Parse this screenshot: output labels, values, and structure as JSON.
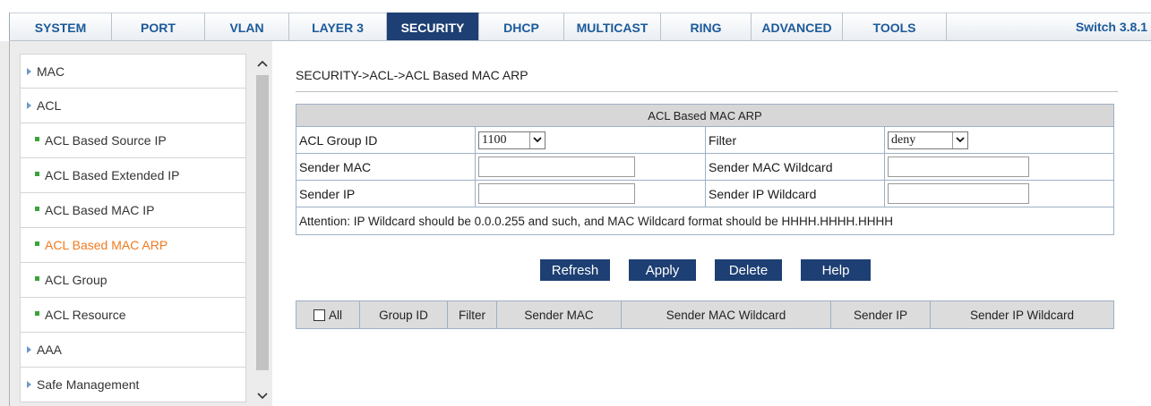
{
  "nav": {
    "tabs": [
      {
        "label": "SYSTEM"
      },
      {
        "label": "PORT"
      },
      {
        "label": "VLAN"
      },
      {
        "label": "LAYER 3"
      },
      {
        "label": "SECURITY",
        "active": true
      },
      {
        "label": "DHCP"
      },
      {
        "label": "MULTICAST"
      },
      {
        "label": "RING"
      },
      {
        "label": "ADVANCED"
      },
      {
        "label": "TOOLS"
      }
    ],
    "version": "Switch 3.8.1"
  },
  "sidebar": {
    "items": [
      {
        "label": "MAC",
        "level": 1
      },
      {
        "label": "ACL",
        "level": 1
      },
      {
        "label": "ACL Based Source IP",
        "level": 2
      },
      {
        "label": "ACL Based Extended IP",
        "level": 2
      },
      {
        "label": "ACL Based MAC IP",
        "level": 2
      },
      {
        "label": "ACL Based MAC ARP",
        "level": 2,
        "active": true
      },
      {
        "label": "ACL Group",
        "level": 2
      },
      {
        "label": "ACL Resource",
        "level": 2
      },
      {
        "label": "AAA",
        "level": 1
      },
      {
        "label": "Safe Management",
        "level": 1
      }
    ]
  },
  "main": {
    "breadcrumb": "SECURITY->ACL->ACL Based MAC ARP",
    "form": {
      "title": "ACL Based MAC ARP",
      "group_id_label": "ACL Group ID",
      "group_id_value": "1100",
      "filter_label": "Filter",
      "filter_value": "deny",
      "sender_mac_label": "Sender MAC",
      "sender_mac_value": "",
      "sender_mac_wildcard_label": "Sender MAC Wildcard",
      "sender_mac_wildcard_value": "",
      "sender_ip_label": "Sender IP",
      "sender_ip_value": "",
      "sender_ip_wildcard_label": "Sender IP Wildcard",
      "sender_ip_wildcard_value": "",
      "attention": "Attention: IP Wildcard should be 0.0.0.255 and such, and MAC Wildcard format should be HHHH.HHHH.HHHH"
    },
    "buttons": {
      "refresh": "Refresh",
      "apply": "Apply",
      "delete": "Delete",
      "help": "Help"
    },
    "table": {
      "all_label": "All",
      "columns": [
        "Group ID",
        "Filter",
        "Sender MAC",
        "Sender MAC Wildcard",
        "Sender IP",
        "Sender IP Wildcard"
      ]
    }
  },
  "colors": {
    "tab_text": "#1c5a9a",
    "tab_active_bg": "#1d3f73",
    "button_bg": "#1d3f73",
    "menu_active_text": "#f07a1f",
    "menu_bullet": "#3aa43a"
  }
}
